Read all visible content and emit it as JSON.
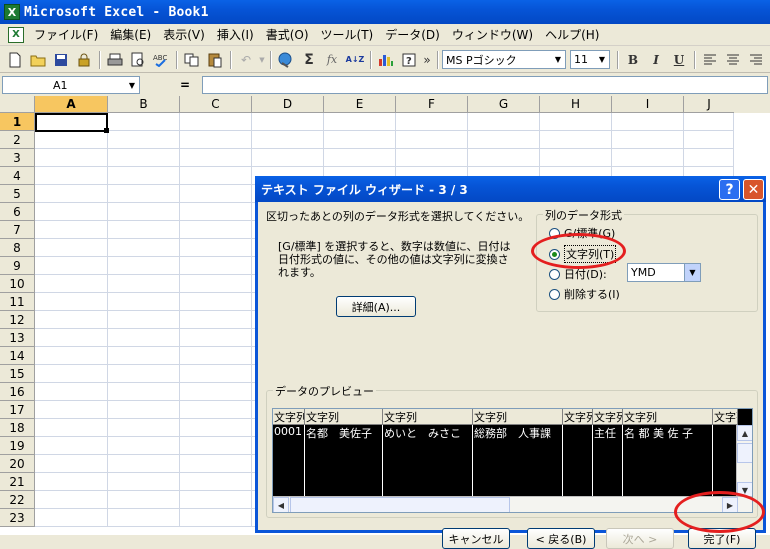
{
  "window": {
    "title": "Microsoft Excel - Book1",
    "app_icon_glyph": "X"
  },
  "menubar": {
    "items": [
      "ファイル(F)",
      "編集(E)",
      "表示(V)",
      "挿入(I)",
      "書式(O)",
      "ツール(T)",
      "データ(D)",
      "ウィンドウ(W)",
      "ヘルプ(H)"
    ]
  },
  "toolbar": {
    "font_name": "MS Pゴシック",
    "font_size": "11",
    "sum_glyph": "Σ",
    "fx_glyph": "fx",
    "sort_glyph": "A↓Z",
    "help_glyph": "?",
    "more_glyph": "»",
    "bold": "B",
    "italic": "I",
    "underline": "U"
  },
  "formula_bar": {
    "name_box": "A1",
    "equals": "="
  },
  "grid": {
    "columns": [
      "A",
      "B",
      "C",
      "D",
      "E",
      "F",
      "G",
      "H",
      "I",
      "J"
    ],
    "rows": [
      "1",
      "2",
      "3",
      "4",
      "5",
      "6",
      "7",
      "8",
      "9",
      "10",
      "11",
      "12",
      "13",
      "14",
      "15",
      "16",
      "17",
      "18",
      "19",
      "20",
      "21",
      "22",
      "23"
    ],
    "active_cell": "A1"
  },
  "dialog": {
    "title": "テキスト ファイル ウィザード - 3 / 3",
    "instruction": "区切ったあとの列のデータ形式を選択してください。",
    "description": "[G/標準] を選択すると、数字は数値に、日付は日付形式の値に、その他の値は文字列に変換されます。",
    "details_button": "詳細(A)...",
    "format_group_label": "列のデータ形式",
    "options": [
      "G/標準(G)",
      "文字列(T)",
      "日付(D):",
      "削除する(I)"
    ],
    "selected_option": "文字列(T)",
    "date_format": "YMD",
    "preview_label": "データのプレビュー",
    "preview_headers": [
      "文字列",
      "文字列",
      "文字列",
      "文字列",
      "文字列",
      "文字列",
      "文字列",
      "文字列"
    ],
    "preview_row": [
      "0001",
      "名都　美佐子",
      "めいと　みさこ",
      "総務部　人事課",
      "",
      "主任",
      "名 都 美 佐 子",
      ""
    ],
    "buttons": {
      "cancel": "キャンセル",
      "back": "< 戻る(B)",
      "next": "次へ >",
      "finish": "完了(F)"
    },
    "help_glyph": "?",
    "close_glyph": "✕"
  },
  "colors": {
    "title_blue": "#0654d6",
    "highlight_red": "#e41f1f",
    "active_header": "#f7c660"
  }
}
